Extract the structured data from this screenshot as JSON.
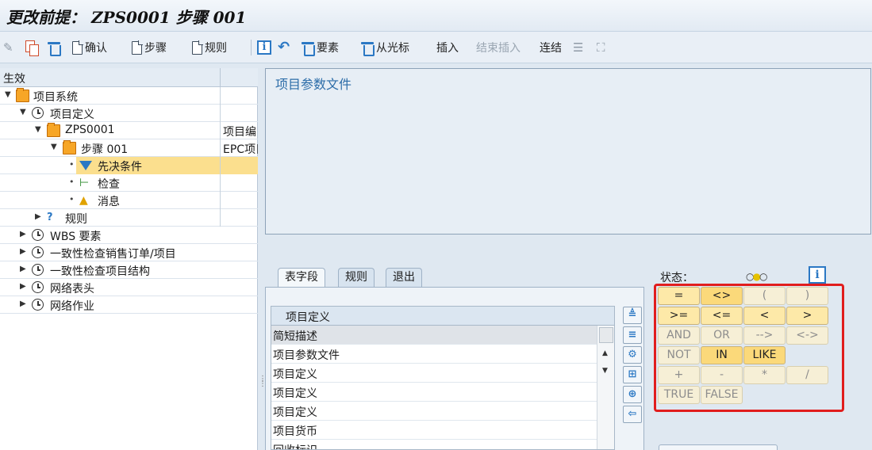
{
  "window": {
    "title": "更改前提： ZPS0001 步骤 001"
  },
  "toolbar": {
    "confirm": "确认",
    "step": "步骤",
    "rule": "规则",
    "element": "要素",
    "from_cursor": "从光标",
    "insert": "插入",
    "end_insert": "结束插入",
    "link": "连结"
  },
  "tree": {
    "header": "生效",
    "rows": [
      {
        "label": "项目系统",
        "col2": ""
      },
      {
        "label": "项目定义",
        "col2": ""
      },
      {
        "label": "ZPS0001",
        "col2": "项目编"
      },
      {
        "label": "步骤 001",
        "col2": "EPC项目"
      },
      {
        "label": "先决条件",
        "col2": ""
      },
      {
        "label": "检查",
        "col2": ""
      },
      {
        "label": "消息",
        "col2": ""
      },
      {
        "label": "规则",
        "col2": ""
      },
      {
        "label": "WBS 要素",
        "col2": ""
      },
      {
        "label": "一致性检查销售订单/项目",
        "col2": ""
      },
      {
        "label": "一致性检查项目结构",
        "col2": ""
      },
      {
        "label": "网络表头",
        "col2": ""
      },
      {
        "label": "网络作业",
        "col2": ""
      }
    ]
  },
  "editor": {
    "text": "项目参数文件"
  },
  "tabs": [
    {
      "label": "表字段"
    },
    {
      "label": "规则"
    },
    {
      "label": "退出"
    }
  ],
  "field_list": {
    "header": "项目定义",
    "items": [
      "简短描述",
      "项目参数文件",
      "项目定义",
      "项目定义",
      "项目定义",
      "项目货币",
      "回收标识"
    ]
  },
  "status": {
    "label": "状态："
  },
  "operators": [
    [
      "=",
      "<>",
      "(",
      ")"
    ],
    [
      ">=",
      "<=",
      "<",
      ">"
    ],
    [
      "AND",
      "OR",
      "-->",
      "<->"
    ],
    [
      "NOT",
      "IN",
      "LIKE"
    ],
    [
      "+",
      "-",
      "*",
      "/"
    ],
    [
      "TRUE",
      "FALSE"
    ]
  ],
  "colors": {
    "highlight_border": "#e11d1d",
    "selection": "#fbdf8e",
    "accent": "#2b78c4"
  }
}
